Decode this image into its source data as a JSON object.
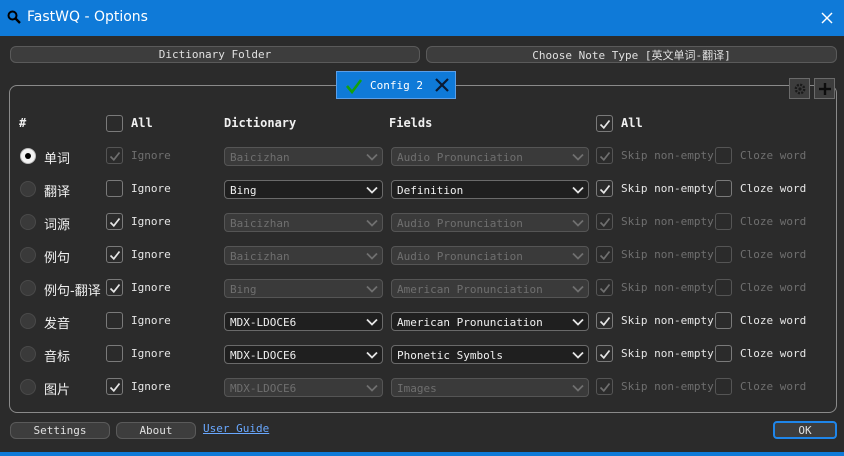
{
  "window": {
    "title": "FastWQ - Options",
    "app_icon": "search-icon",
    "close_icon": "close-icon"
  },
  "toolbar": {
    "dictionary_folder_label": "Dictionary Folder",
    "choose_note_type_label": "Choose Note Type [英文单词-翻译]"
  },
  "tab": {
    "label": "Config 2",
    "check_icon": "checkmark-icon",
    "close_icon": "close-icon"
  },
  "panel_buttons": {
    "settings_icon": "gear-icon",
    "add_icon": "plus-icon"
  },
  "headers": {
    "index": "#",
    "all_left": "All",
    "dictionary": "Dictionary",
    "fields": "Fields",
    "all_right": "All"
  },
  "header_checks": {
    "all_left_checked": false,
    "all_right_checked": true
  },
  "rows": [
    {
      "word": "单词",
      "selected": true,
      "ignore": true,
      "ignore_disabled": true,
      "enabled": false,
      "dictionary": "Baicizhan",
      "field": "Audio Pronunciation",
      "skip_non_empty": true,
      "cloze_word": false
    },
    {
      "word": "翻译",
      "selected": false,
      "ignore": false,
      "ignore_disabled": false,
      "enabled": true,
      "dictionary": "Bing",
      "field": "Definition",
      "skip_non_empty": true,
      "cloze_word": false
    },
    {
      "word": "词源",
      "selected": false,
      "ignore": true,
      "ignore_disabled": false,
      "enabled": false,
      "dictionary": "Baicizhan",
      "field": "Audio Pronunciation",
      "skip_non_empty": true,
      "cloze_word": false
    },
    {
      "word": "例句",
      "selected": false,
      "ignore": true,
      "ignore_disabled": false,
      "enabled": false,
      "dictionary": "Baicizhan",
      "field": "Audio Pronunciation",
      "skip_non_empty": true,
      "cloze_word": false
    },
    {
      "word": "例句-翻译",
      "selected": false,
      "ignore": true,
      "ignore_disabled": false,
      "enabled": false,
      "dictionary": "Bing",
      "field": "American Pronunciation",
      "skip_non_empty": true,
      "cloze_word": false
    },
    {
      "word": "发音",
      "selected": false,
      "ignore": false,
      "ignore_disabled": false,
      "enabled": true,
      "dictionary": "MDX-LDOCE6",
      "field": "American Pronunciation",
      "skip_non_empty": true,
      "cloze_word": false
    },
    {
      "word": "音标",
      "selected": false,
      "ignore": false,
      "ignore_disabled": false,
      "enabled": true,
      "dictionary": "MDX-LDOCE6",
      "field": "Phonetic Symbols",
      "skip_non_empty": true,
      "cloze_word": false
    },
    {
      "word": "图片",
      "selected": false,
      "ignore": true,
      "ignore_disabled": false,
      "enabled": false,
      "dictionary": "MDX-LDOCE6",
      "field": "Images",
      "skip_non_empty": true,
      "cloze_word": false
    }
  ],
  "row_labels": {
    "ignore": "Ignore",
    "skip_non_empty": "Skip non-empty",
    "cloze_word": "Cloze word"
  },
  "footer": {
    "settings_label": "Settings",
    "about_label": "About",
    "user_guide_label": "User Guide",
    "ok_label": "OK"
  },
  "colors": {
    "accent": "#0f7ad8",
    "background": "#2b2b2b",
    "link": "#69a8ff"
  }
}
